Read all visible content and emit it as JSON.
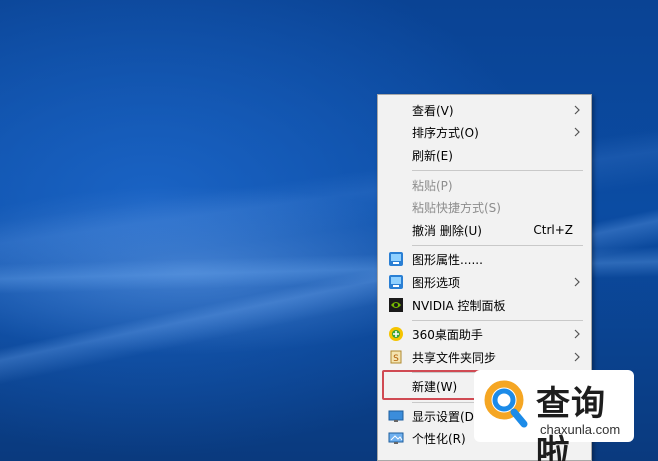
{
  "context_menu": {
    "items": [
      {
        "label": "查看(V)"
      },
      {
        "label": "排序方式(O)"
      },
      {
        "label": "刷新(E)"
      },
      {
        "label": "粘贴(P)"
      },
      {
        "label": "粘贴快捷方式(S)"
      },
      {
        "label": "撤消 删除(U)",
        "shortcut": "Ctrl+Z"
      },
      {
        "label": "图形属性......"
      },
      {
        "label": "图形选项"
      },
      {
        "label": "NVIDIA 控制面板"
      },
      {
        "label": "360桌面助手"
      },
      {
        "label": "共享文件夹同步"
      },
      {
        "label": "新建(W)"
      },
      {
        "label": "显示设置(D)"
      },
      {
        "label": "个性化(R)"
      }
    ]
  },
  "watermark": {
    "title": "查询啦",
    "subtitle": "chaxunla.com"
  },
  "colors": {
    "desktop": "#0b4ca3",
    "menu_bg": "#f2f2f2",
    "highlight_border": "#d04a53",
    "disabled_text": "#8d8d8d"
  }
}
